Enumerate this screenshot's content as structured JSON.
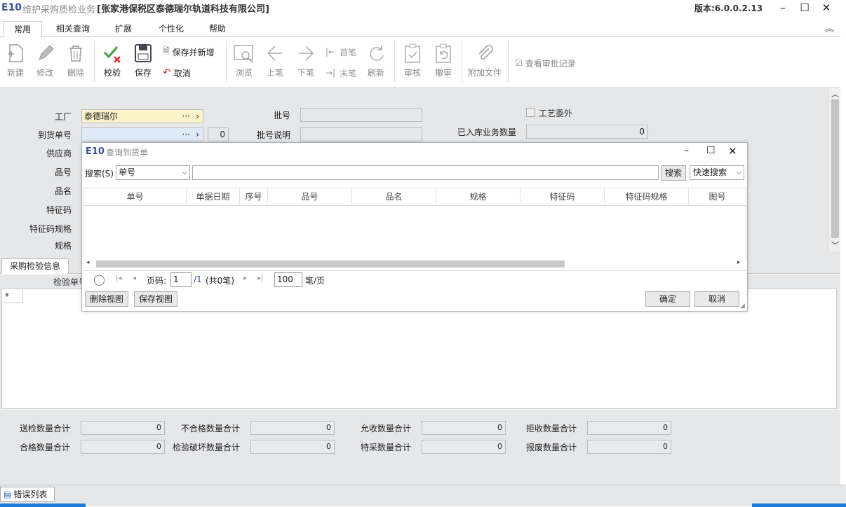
{
  "window": {
    "logo": "E10",
    "module": "维护采购质检业务",
    "company": "[张家港保税区泰德瑞尔轨道科技有限公司]",
    "version": "版本:6.0.0.2.13"
  },
  "menu_tabs": [
    "常用",
    "相关查询",
    "扩展",
    "个性化",
    "帮助"
  ],
  "ribbon": {
    "new": "新建",
    "edit": "修改",
    "delete": "删除",
    "check": "校验",
    "save": "保存",
    "save_and_new": "保存并新增",
    "cancel": "取消",
    "browse": "浏览",
    "prev": "上笔",
    "next": "下笔",
    "first": "首笔",
    "last": "末笔",
    "refresh": "刷新",
    "approve": "审核",
    "unapprove": "撤审",
    "attach": "附加文件",
    "view_approval": "查看审批记录"
  },
  "form": {
    "factory_label": "工厂",
    "factory_value": "泰德瑞尔",
    "arrival_no_label": "到货单号",
    "arrival_count": "0",
    "supplier_label": "供应商",
    "item_no_label": "品号",
    "item_name_label": "品名",
    "feature_label": "特征码",
    "feature_spec_label": "特征码规格",
    "spec_label": "规格",
    "batch_label": "批号",
    "batch_desc_label": "批号说明",
    "outsourced_label": "工艺委外",
    "stocked_qty_label": "已入库业务数量",
    "stocked_qty_value": "0",
    "ellipsis": "···",
    "arrow": "›"
  },
  "detail_tab": "采购检验信息",
  "grid": {
    "col_partial": "检验单号",
    "new_row_marker": "*"
  },
  "totals": [
    {
      "label": "送检数量合计",
      "value": "0"
    },
    {
      "label": "不合格数量合计",
      "value": "0"
    },
    {
      "label": "允收数量合计",
      "value": "0"
    },
    {
      "label": "拒收数量合计",
      "value": "0"
    },
    {
      "label": "合格数量合计",
      "value": "0"
    },
    {
      "label": "检验破坏数量合计",
      "value": "0"
    },
    {
      "label": "特采数量合计",
      "value": "0"
    },
    {
      "label": "报废数量合计",
      "value": "0"
    }
  ],
  "status_tab": "错误列表",
  "dialog": {
    "logo": "E10",
    "title": "查询到货单",
    "search_label": "搜索(S)",
    "search_field": "单号",
    "search_text": "",
    "search_button": "搜索",
    "quick_search": "快速搜索",
    "columns": [
      "单号",
      "单据日期",
      "序号",
      "品号",
      "品名",
      "规格",
      "特征码",
      "特征码规格",
      "图号"
    ],
    "pager": {
      "page_label": "页码:",
      "page": "1",
      "total_pages": "/1",
      "total_records": "(共0笔)",
      "page_size": "100",
      "per_page_label": "笔/页"
    },
    "delete_view": "删除视图",
    "save_view": "保存视图",
    "ok": "确定",
    "cancel": "取消"
  }
}
